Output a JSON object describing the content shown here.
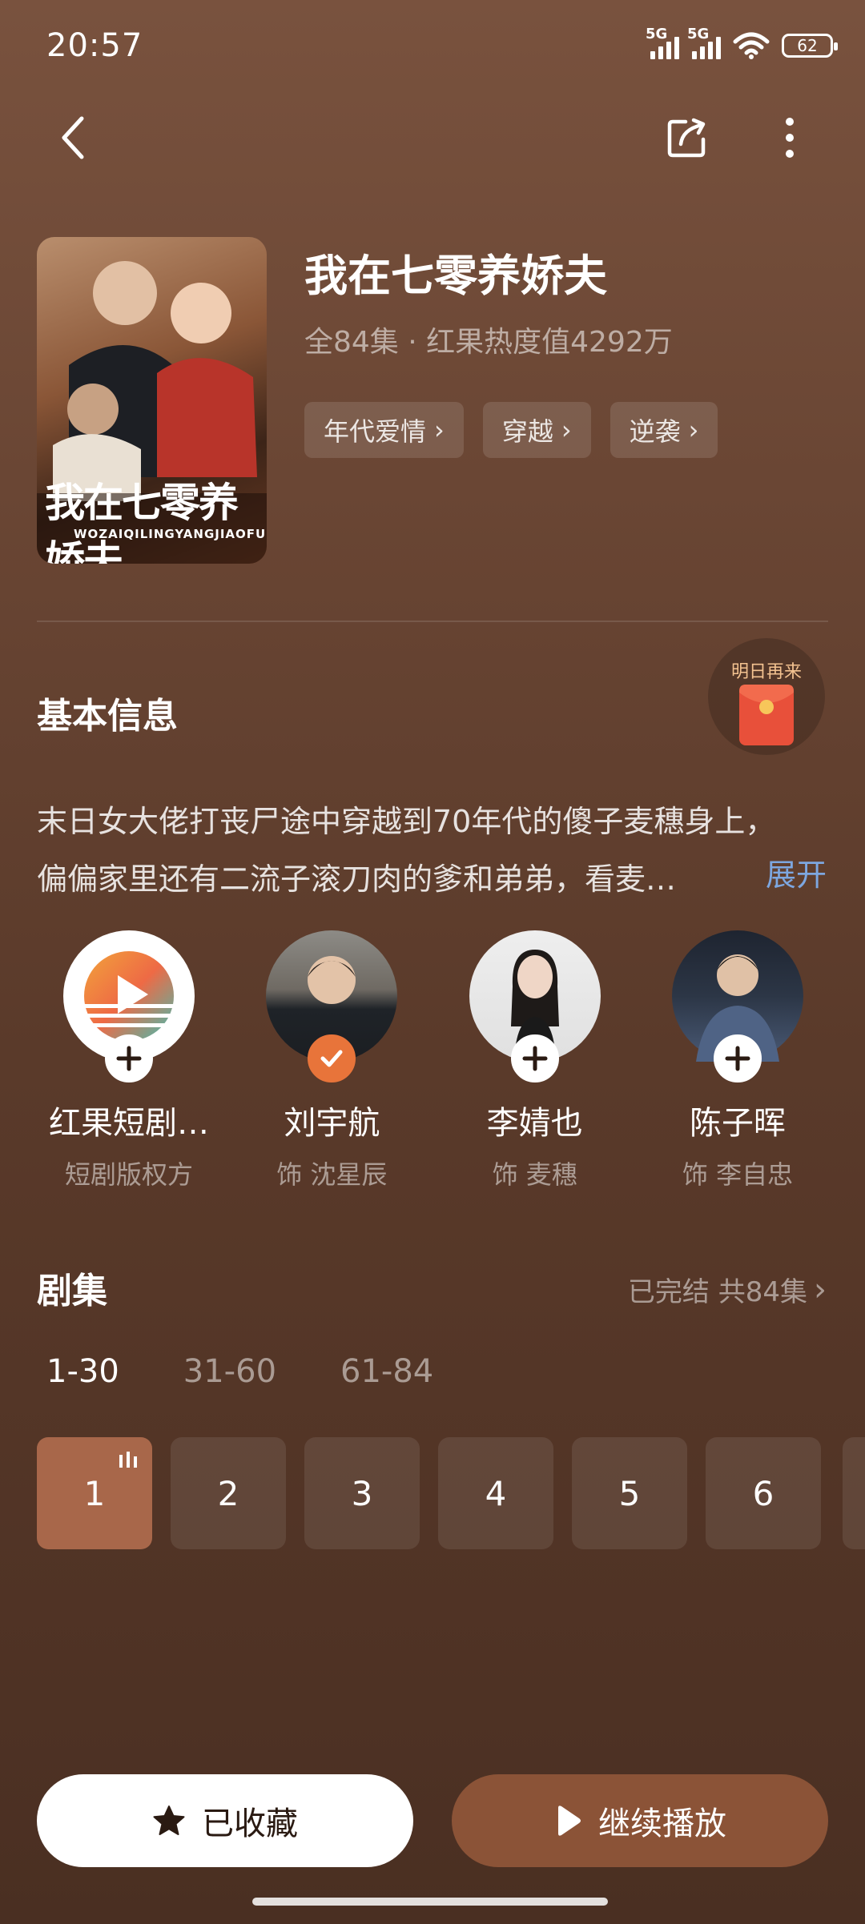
{
  "status_bar": {
    "time": "20:57",
    "sim1": "5G",
    "sim2": "5G",
    "battery": "62"
  },
  "drama": {
    "title": "我在七零养娇夫",
    "subtitle": "全84集 · 红果热度值4292万",
    "poster_text": "我在七零养娇夫",
    "poster_pinyin": "WOZAIQILINGYANGJIAOFU",
    "tags": [
      "年代爱情",
      "穿越",
      "逆袭"
    ]
  },
  "basic_info": {
    "title": "基本信息",
    "reward_label": "明日再来",
    "description_line1": "末日女大佬打丧尸途中穿越到70年代的傻子麦穗身上，",
    "description_line2": "偏偏家里还有二流子滚刀肉的爹和弟弟，看麦…",
    "expand_label": "展开"
  },
  "cast": [
    {
      "name": "红果短剧…",
      "role": "短剧版权方",
      "followed": false
    },
    {
      "name": "刘宇航",
      "role": "饰 沈星辰",
      "followed": true
    },
    {
      "name": "李婧也",
      "role": "饰 麦穗",
      "followed": false
    },
    {
      "name": "陈子晖",
      "role": "饰 李自忠",
      "followed": false
    }
  ],
  "episodes_section": {
    "title": "剧集",
    "status": "已完结 共84集",
    "ranges": [
      "1-30",
      "31-60",
      "61-84"
    ],
    "active_range": "1-30",
    "episodes": [
      "1",
      "2",
      "3",
      "4",
      "5",
      "6"
    ],
    "playing_episode": "1"
  },
  "actions": {
    "collect_label": "已收藏",
    "play_label": "继续播放"
  },
  "colors": {
    "accent": "#a8674a",
    "play_button": "#8b5337",
    "check_badge": "#e8743a",
    "link": "#7da7e0"
  }
}
